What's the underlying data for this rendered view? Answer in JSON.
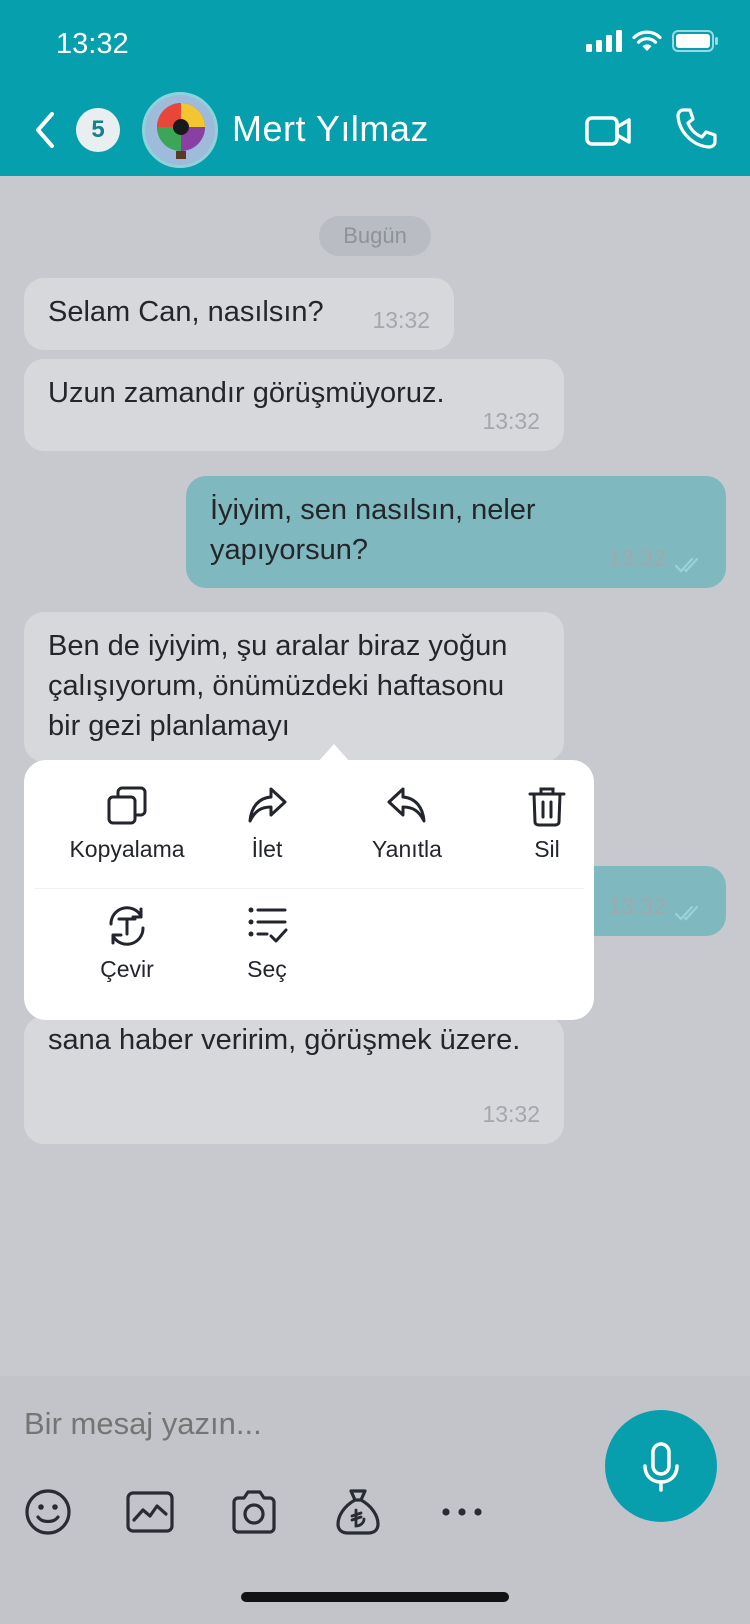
{
  "status_bar": {
    "time": "13:32"
  },
  "header": {
    "unread_count": "5",
    "contact_name": "Mert Yılmaz",
    "icons": [
      "back-chevron-icon",
      "video-camera-icon",
      "phone-icon"
    ]
  },
  "chat": {
    "date_label": "Bugün",
    "messages": [
      {
        "direction": "in",
        "text": "Selam Can, nasılsın?",
        "time": "13:32"
      },
      {
        "direction": "in",
        "text": "Uzun zamandır görüşmüyoruz.",
        "time": "13:32"
      },
      {
        "direction": "out",
        "text": "İyiyim, sen nasılsın, neler yapıyorsun?",
        "time": "13:32",
        "read": true
      },
      {
        "direction": "in",
        "text": "Ben de iyiyim, şu aralar biraz yoğun çalışıyorum, önümüzdeki haftasonu bir gezi planlamayı",
        "time": "",
        "partially_hidden": true
      },
      {
        "direction": "out",
        "text": "",
        "time": "13:32",
        "read": true,
        "partially_hidden": true
      },
      {
        "direction": "in",
        "text": "sana haber veririm, görüşmek üzere.",
        "time": "13:32",
        "partially_hidden": true
      }
    ]
  },
  "context_menu": {
    "items": [
      {
        "label": "Kopyalama",
        "icon": "copy-icon"
      },
      {
        "label": "İlet",
        "icon": "forward-icon"
      },
      {
        "label": "Yanıtla",
        "icon": "reply-icon"
      },
      {
        "label": "Sil",
        "icon": "trash-icon"
      },
      {
        "label": "Çevir",
        "icon": "translate-icon"
      },
      {
        "label": "Seç",
        "icon": "select-list-icon"
      }
    ]
  },
  "composer": {
    "placeholder": "Bir mesaj yazın...",
    "tools": [
      "emoji-icon",
      "gallery-icon",
      "camera-icon",
      "money-bag-icon",
      "more-icon"
    ],
    "mic_icon": "microphone-icon"
  },
  "colors": {
    "header": "#059fae",
    "chat_background": "#c8c9ce",
    "incoming_bubble": "#d7d8db",
    "outgoing_bubble": "#7fb9bf",
    "mic_button": "#079eae"
  }
}
